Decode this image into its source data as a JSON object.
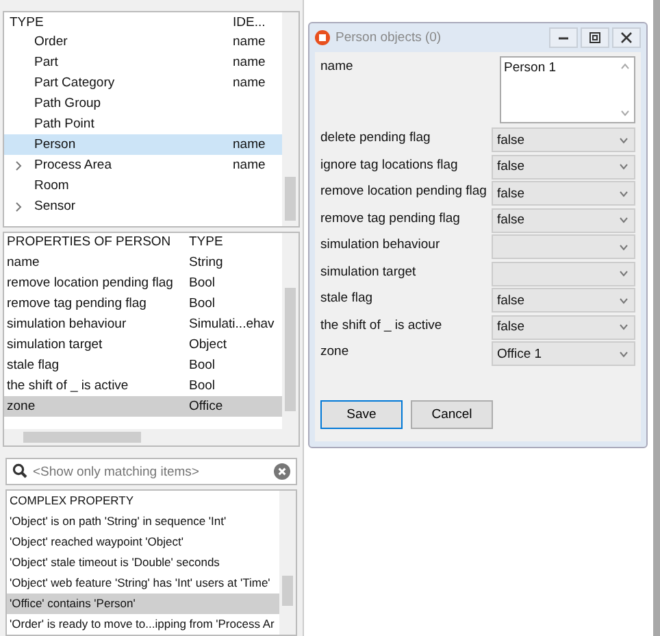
{
  "type_tree": {
    "columns": [
      "TYPE",
      "IDE..."
    ],
    "rows": [
      {
        "label": "Order",
        "ident": "name",
        "has_children": false,
        "selected": false
      },
      {
        "label": "Part",
        "ident": "name",
        "has_children": false,
        "selected": false
      },
      {
        "label": "Part Category",
        "ident": "name",
        "has_children": false,
        "selected": false
      },
      {
        "label": "Path Group",
        "ident": "",
        "has_children": false,
        "selected": false
      },
      {
        "label": "Path Point",
        "ident": "",
        "has_children": false,
        "selected": false
      },
      {
        "label": "Person",
        "ident": "name",
        "has_children": false,
        "selected": true
      },
      {
        "label": "Process Area",
        "ident": "name",
        "has_children": true,
        "selected": false
      },
      {
        "label": "Room",
        "ident": "",
        "has_children": false,
        "selected": false
      },
      {
        "label": "Sensor",
        "ident": "",
        "has_children": true,
        "selected": false
      }
    ]
  },
  "properties": {
    "columns": [
      "PROPERTIES OF PERSON",
      "TYPE"
    ],
    "rows": [
      {
        "name": "name",
        "type": "String",
        "selected": false
      },
      {
        "name": "remove location pending flag",
        "type": "Bool",
        "selected": false
      },
      {
        "name": "remove tag pending flag",
        "type": "Bool",
        "selected": false
      },
      {
        "name": "simulation behaviour",
        "type": "Simulati...ehav",
        "selected": false
      },
      {
        "name": "simulation target",
        "type": "Object",
        "selected": false
      },
      {
        "name": "stale flag",
        "type": "Bool",
        "selected": false
      },
      {
        "name": "the shift of _ is active",
        "type": "Bool",
        "selected": false
      },
      {
        "name": "zone",
        "type": "Office",
        "selected": true
      }
    ]
  },
  "filter": {
    "placeholder": "<Show only matching items>"
  },
  "complex_properties": {
    "header": "COMPLEX PROPERTY",
    "items": [
      {
        "text": "'Object' is on path 'String' in sequence 'Int'",
        "selected": false
      },
      {
        "text": "'Object' reached waypoint 'Object'",
        "selected": false
      },
      {
        "text": "'Object' stale timeout is 'Double' seconds",
        "selected": false
      },
      {
        "text": "'Object' web feature 'String' has 'Int' users at 'Time'",
        "selected": false
      },
      {
        "text": "'Office' contains 'Person'",
        "selected": true
      },
      {
        "text": "'Order' is ready to move to...ipping from 'Process Ar",
        "selected": false
      }
    ]
  },
  "dialog": {
    "title": "Person objects (0)",
    "fields": [
      {
        "label": "name",
        "kind": "textarea",
        "value": "Person 1"
      },
      {
        "label": "delete pending flag",
        "kind": "select",
        "value": "false"
      },
      {
        "label": "ignore tag locations flag",
        "kind": "select",
        "value": "false"
      },
      {
        "label": "remove location pending flag",
        "kind": "select",
        "value": "false"
      },
      {
        "label": "remove tag pending flag",
        "kind": "select",
        "value": "false"
      },
      {
        "label": "simulation behaviour",
        "kind": "select"
      },
      {
        "label": "simulation target",
        "kind": "select"
      },
      {
        "label": "stale flag",
        "kind": "select",
        "value": "false"
      },
      {
        "label": "the shift of _ is active",
        "kind": "select",
        "value": "false"
      },
      {
        "label": "zone",
        "kind": "select",
        "value": "Office 1"
      }
    ],
    "buttons": [
      {
        "label": "Save",
        "default": true
      },
      {
        "label": "Cancel",
        "default": false
      }
    ]
  }
}
